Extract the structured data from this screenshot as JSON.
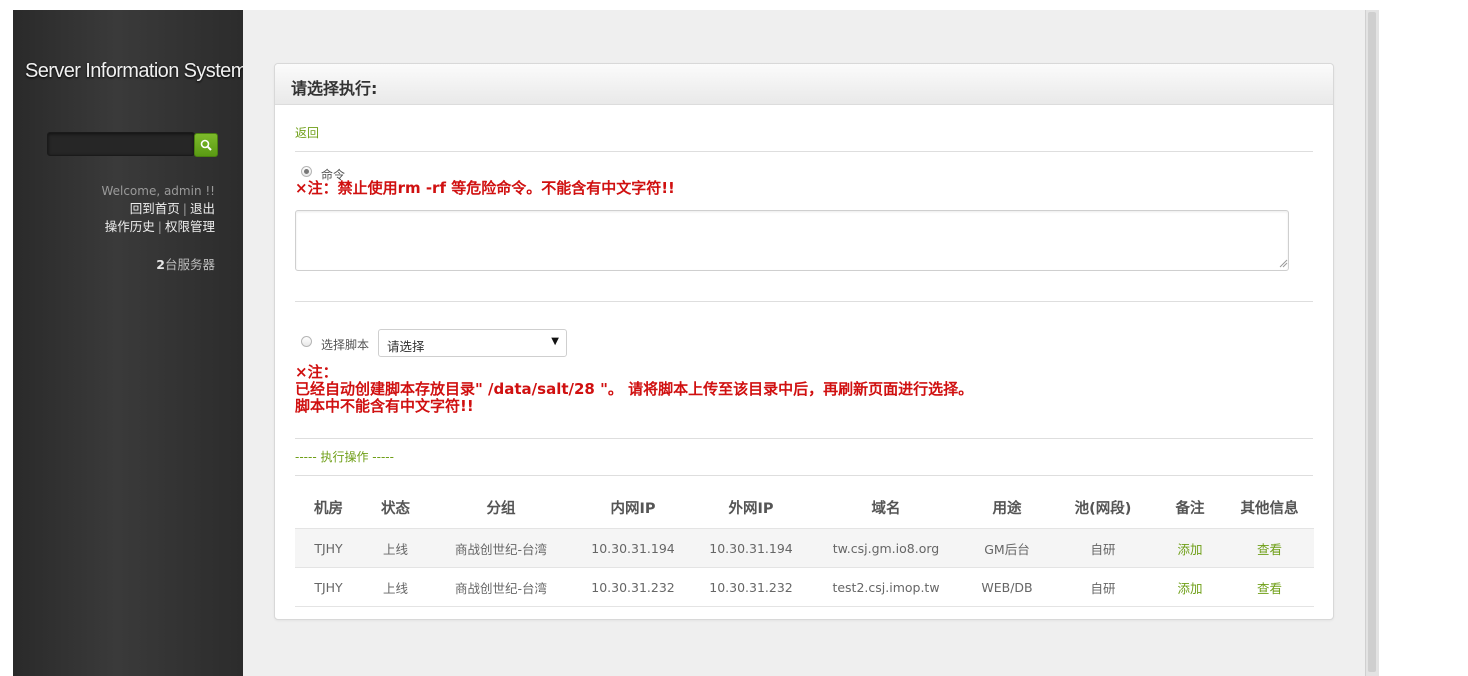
{
  "sidebar": {
    "brand": "Server Information System",
    "search_placeholder": "",
    "welcome": "Welcome, admin !!",
    "links": {
      "home": "回到首页",
      "logout": "退出",
      "history": "操作历史",
      "permissions": "权限管理"
    },
    "server_count_number": "2",
    "server_count_suffix": "台服务器"
  },
  "panel": {
    "title": "请选择执行:",
    "back": "返回",
    "command": {
      "label": "命令",
      "selected": true,
      "warning": "×注：禁止使用rm -rf 等危险命令。不能含有中文字符!!",
      "value": ""
    },
    "script": {
      "label": "选择脚本",
      "selected": false,
      "select_value": "请选择",
      "warning_line1": "×注：",
      "warning_line2": "已经自动创建脚本存放目录\" /data/salt/28 \"。 请将脚本上传至该目录中后，再刷新页面进行选择。",
      "warning_line3": "脚本中不能含有中文字符!!"
    },
    "section_label": "----- 执行操作 -----"
  },
  "table": {
    "headers": [
      "机房",
      "状态",
      "分组",
      "内网IP",
      "外网IP",
      "域名",
      "用途",
      "池(网段)",
      "备注",
      "其他信息"
    ],
    "rows": [
      {
        "room": "TJHY",
        "status": "上线",
        "group": "商战创世纪-台湾",
        "internal_ip": "10.30.31.194",
        "external_ip": "10.30.31.194",
        "domain": "tw.csj.gm.io8.org",
        "usage": "GM后台",
        "pool": "自研",
        "note": "添加",
        "info": "查看"
      },
      {
        "room": "TJHY",
        "status": "上线",
        "group": "商战创世纪-台湾",
        "internal_ip": "10.30.31.232",
        "external_ip": "10.30.31.232",
        "domain": "test2.csj.imop.tw",
        "usage": "WEB/DB",
        "pool": "自研",
        "note": "添加",
        "info": "查看"
      }
    ]
  },
  "colors": {
    "sidebar_bg": "#2f2f2f",
    "accent_green": "#6f9f18",
    "warning_red": "#d01010"
  }
}
